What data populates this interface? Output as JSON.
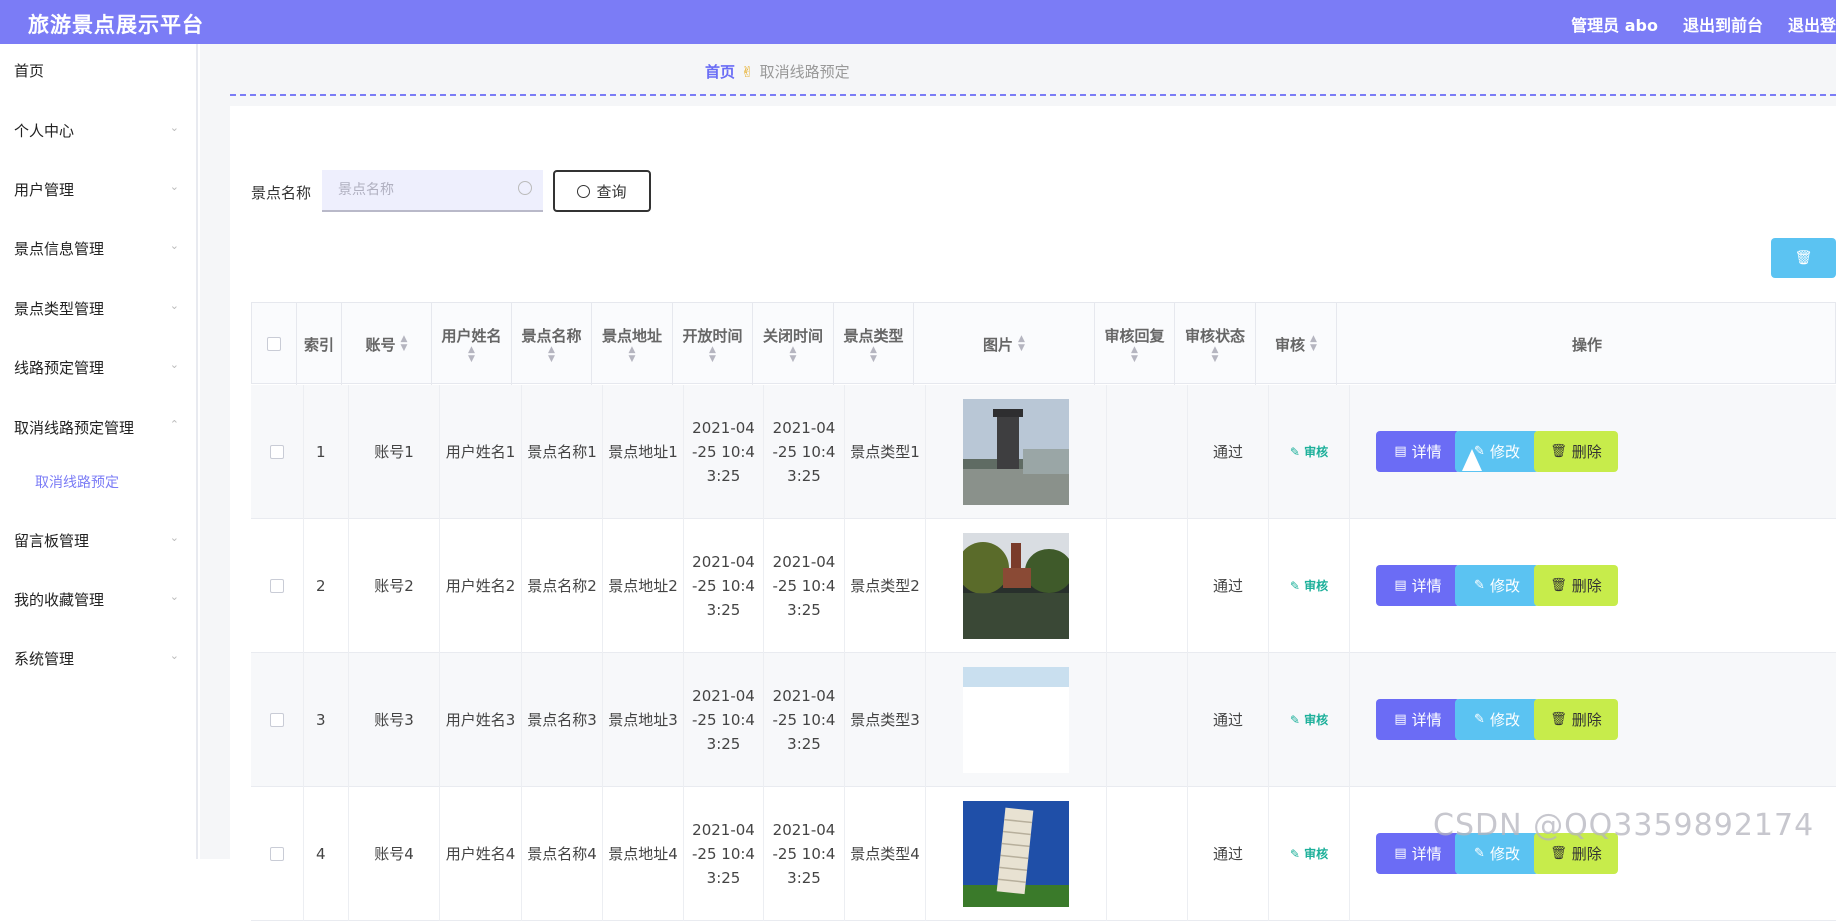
{
  "header": {
    "title": "旅游景点展示平台",
    "admin": "管理员 abo",
    "to_front": "退出到前台",
    "logout": "退出登"
  },
  "sidebar": {
    "items": [
      {
        "label": "首页"
      },
      {
        "label": "个人中心"
      },
      {
        "label": "用户管理"
      },
      {
        "label": "景点信息管理"
      },
      {
        "label": "景点类型管理"
      },
      {
        "label": "线路预定管理"
      },
      {
        "label": "取消线路预定管理"
      },
      {
        "label": "留言板管理"
      },
      {
        "label": "我的收藏管理"
      },
      {
        "label": "系统管理"
      }
    ],
    "sub_item": "取消线路预定"
  },
  "breadcrumb": {
    "home": "首页",
    "current": "取消线路预定"
  },
  "search": {
    "label": "景点名称",
    "placeholder": "景点名称",
    "query_button": "查询"
  },
  "table": {
    "columns": [
      "索引",
      "账号",
      "用户姓名",
      "景点名称",
      "景点地址",
      "开放时间",
      "关闭时间",
      "景点类型",
      "图片",
      "审核回复",
      "审核状态",
      "审核",
      "操作"
    ],
    "rows": [
      {
        "index": "1",
        "account": "账号1",
        "user_name": "用户姓名1",
        "spot_name": "景点名称1",
        "spot_addr": "景点地址1",
        "open_time": "2021-04-25 10:43:25",
        "close_time": "2021-04-25 10:43:25",
        "spot_type": "景点类型1",
        "image": "monument-city",
        "reply": "",
        "status": "通过",
        "audit": "审核"
      },
      {
        "index": "2",
        "account": "账号2",
        "user_name": "用户姓名2",
        "spot_name": "景点名称2",
        "spot_addr": "景点地址2",
        "open_time": "2021-04-25 10:43:25",
        "close_time": "2021-04-25 10:43:25",
        "spot_type": "景点类型2",
        "image": "lake-church",
        "reply": "",
        "status": "通过",
        "audit": "审核"
      },
      {
        "index": "3",
        "account": "账号3",
        "user_name": "用户姓名3",
        "spot_name": "景点名称3",
        "spot_addr": "景点地址3",
        "open_time": "2021-04-25 10:43:25",
        "close_time": "2021-04-25 10:43:25",
        "spot_type": "景点类型3",
        "image": "sky-partial",
        "reply": "",
        "status": "通过",
        "audit": "审核"
      },
      {
        "index": "4",
        "account": "账号4",
        "user_name": "用户姓名4",
        "spot_name": "景点名称4",
        "spot_addr": "景点地址4",
        "open_time": "2021-04-25 10:43:25",
        "close_time": "2021-04-25 10:43:25",
        "spot_type": "景点类型4",
        "image": "leaning-tower",
        "reply": "",
        "status": "通过",
        "audit": "审核"
      }
    ],
    "actions": {
      "detail": "详情",
      "edit": "修改",
      "delete": "删除"
    }
  },
  "watermark": "CSDN @QQ3359892174",
  "colors": {
    "accent": "#7b7cf6",
    "detail": "#6b6cf5",
    "edit": "#5bc3f2",
    "delete": "#c7ec4b",
    "audit": "#1db09a"
  }
}
